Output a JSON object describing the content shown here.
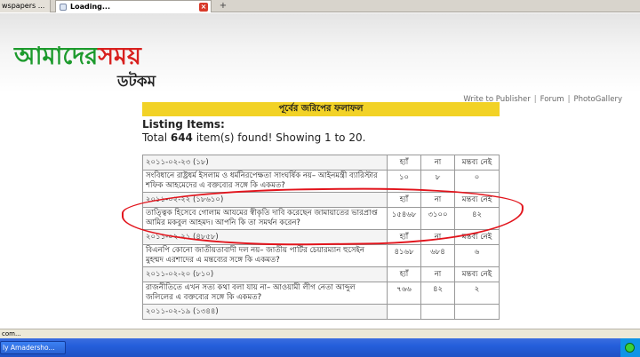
{
  "browser": {
    "tabs": [
      {
        "label": "wspapers ..."
      },
      {
        "label": "Loading..."
      }
    ],
    "status_text": "com..."
  },
  "logo": {
    "main_green": "আমাদের",
    "main_red": "সময়",
    "sub": "ডটকম"
  },
  "top_links": [
    "Write to Publisher",
    "Forum",
    "PhotoGallery"
  ],
  "section_title": "পূর্বের জরিপের ফলাফল",
  "listing": {
    "title": "Listing Items:",
    "total_prefix": "Total ",
    "total_count": "644",
    "total_suffix": " item(s) found! Showing 1 to 20."
  },
  "poll_columns": {
    "yes": "হ্যাঁ",
    "no": "না",
    "no_comment": "মন্তব্য নেই"
  },
  "polls": [
    {
      "date": "২০১১-০২-২৩ (১৮)",
      "question": "সংবিধানে রাষ্ট্রধর্ম ইসলাম ও ধর্মনিরপেক্ষতা সাংঘর্ষিক নয়– আইনমন্ত্রী ব্যারিস্টার শফিক আহমেদের এ বক্তব্যের সঙ্গে কি একমত?",
      "yes": "১০",
      "no": "৮",
      "no_comment": "০"
    },
    {
      "date": "২০১১-০২-২২ (১৮৬১০)",
      "question": "তাত্ত্বিক হিসেবে গোলাম আযমের স্বীকৃতি দাবি করেছেন জামায়াতের ভারপ্রাপ্ত আমির মকবুল আহমদ। আপনি কি তা সমর্থন করেন?",
      "yes": "১৫৪৬৮",
      "no": "৩১০০",
      "no_comment": "৪২"
    },
    {
      "date": "২০১১-০২-২১ (৪৮৫৮)",
      "question": "বিএনপি কোনো জাতীয়তাবাদী দল নয়– জাতীয় পার্টির চেয়ারম্যান হুসেইন মুহম্মদ এরশাদের এ মন্তব্যের সঙ্গে কি একমত?",
      "yes": "৪১৬৮",
      "no": "৬৮৪",
      "no_comment": "৬"
    },
    {
      "date": "২০১১-০২-২০ (৮১০)",
      "question": "রাজনীতিতে এখন সত্য কথা বলা যায় না– আওয়ামী লীগ নেতা আব্দুল জলিলের এ বক্তব্যের সঙ্গে কি একমত?",
      "yes": "৭৬৬",
      "no": "৪২",
      "no_comment": "২"
    },
    {
      "date": "২০১১-০২-১৯ (১৩৪৪)"
    }
  ],
  "taskbar": {
    "button_label": "ly Amadersho..."
  }
}
